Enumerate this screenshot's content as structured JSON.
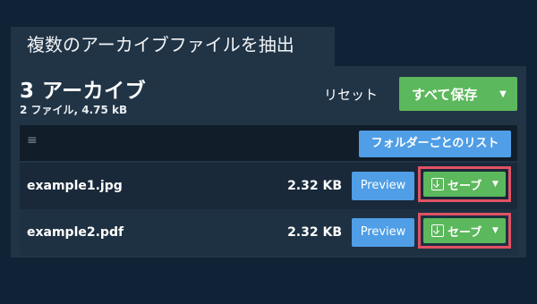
{
  "header": {
    "title": "複数のアーカイブファイルを抽出"
  },
  "summary": {
    "archive_count": "3 アーカイブ",
    "details": "2 ファイル, 4.75 kB"
  },
  "toolbar": {
    "reset_label": "リセット",
    "save_all_label": "すべて保存",
    "caret": "▼"
  },
  "list": {
    "menu_icon": "≡",
    "folder_list_label": "フォルダーごとのリスト",
    "files": [
      {
        "name": "example1.jpg",
        "size": "2.32 KB",
        "preview_label": "Preview",
        "save_label": "セーブ",
        "caret": "▼"
      },
      {
        "name": "example2.pdf",
        "size": "2.32 KB",
        "preview_label": "Preview",
        "save_label": "セーブ",
        "caret": "▼"
      }
    ]
  },
  "colors": {
    "background": "#0f2236",
    "panel": "#213446",
    "green": "#5cb85c",
    "blue": "#4f9ee6",
    "highlight": "#e05263"
  }
}
